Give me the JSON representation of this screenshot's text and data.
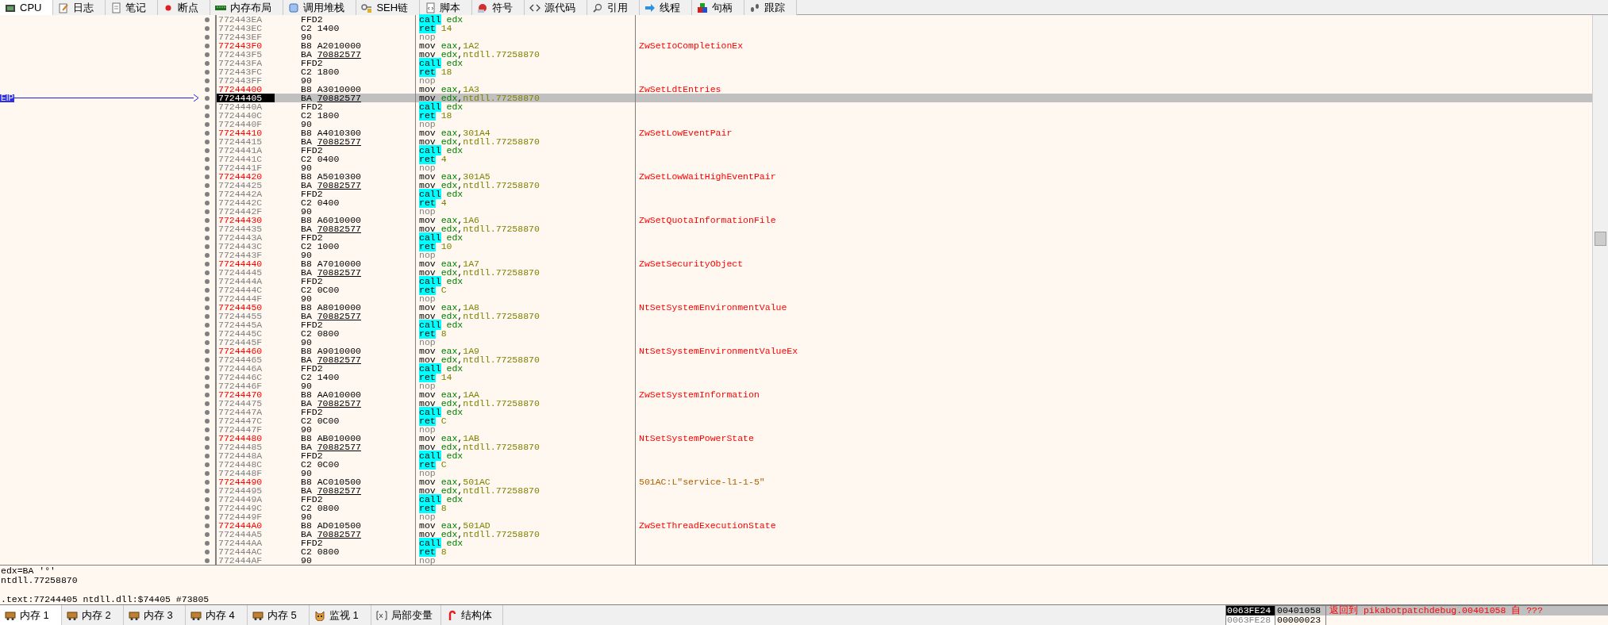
{
  "top_tabs": [
    {
      "label": "CPU",
      "selected": true
    },
    {
      "label": "日志",
      "selected": false
    },
    {
      "label": "笔记",
      "selected": false
    },
    {
      "label": "断点",
      "selected": false
    },
    {
      "label": "内存布局",
      "selected": false
    },
    {
      "label": "调用堆栈",
      "selected": false
    },
    {
      "label": "SEH链",
      "selected": false
    },
    {
      "label": "脚本",
      "selected": false
    },
    {
      "label": "符号",
      "selected": false
    },
    {
      "label": "源代码",
      "selected": false
    },
    {
      "label": "引用",
      "selected": false
    },
    {
      "label": "线程",
      "selected": false
    },
    {
      "label": "句柄",
      "selected": false
    },
    {
      "label": "跟踪",
      "selected": false
    }
  ],
  "eip_label": "EIP",
  "rows": [
    {
      "address": "772443EA",
      "label": false,
      "selected": false,
      "eip": false,
      "bytes": [
        "FFD2"
      ],
      "reloc": false,
      "mnemonic": "call",
      "kind": "call",
      "operands": "edx"
    },
    {
      "address": "772443EC",
      "label": false,
      "selected": false,
      "eip": false,
      "bytes": [
        "C2",
        "1400"
      ],
      "reloc": false,
      "mnemonic": "ret",
      "kind": "ret",
      "operands": "14"
    },
    {
      "address": "772443EF",
      "label": false,
      "selected": false,
      "eip": false,
      "bytes": [
        "90"
      ],
      "reloc": false,
      "mnemonic": "nop",
      "kind": "nop"
    },
    {
      "address": "772443F0",
      "label": true,
      "selected": false,
      "eip": false,
      "bytes": [
        "B8",
        "A2010000"
      ],
      "reloc": false,
      "mnemonic": "mov",
      "kind": "mov",
      "operands": "eax,1A2",
      "comment": {
        "text": "ZwSetIoCompletionEx",
        "kind": "label"
      }
    },
    {
      "address": "772443F5",
      "label": false,
      "selected": false,
      "eip": false,
      "bytes": [
        "BA",
        "70882577"
      ],
      "reloc": true,
      "mnemonic": "mov",
      "kind": "mov",
      "operands": "edx,ntdll.77258870"
    },
    {
      "address": "772443FA",
      "label": false,
      "selected": false,
      "eip": false,
      "bytes": [
        "FFD2"
      ],
      "reloc": false,
      "mnemonic": "call",
      "kind": "call",
      "operands": "edx"
    },
    {
      "address": "772443FC",
      "label": false,
      "selected": false,
      "eip": false,
      "bytes": [
        "C2",
        "1800"
      ],
      "reloc": false,
      "mnemonic": "ret",
      "kind": "ret",
      "operands": "18"
    },
    {
      "address": "772443FF",
      "label": false,
      "selected": false,
      "eip": false,
      "bytes": [
        "90"
      ],
      "reloc": false,
      "mnemonic": "nop",
      "kind": "nop"
    },
    {
      "address": "77244400",
      "label": true,
      "selected": false,
      "eip": false,
      "bytes": [
        "B8",
        "A3010000"
      ],
      "reloc": false,
      "mnemonic": "mov",
      "kind": "mov",
      "operands": "eax,1A3",
      "comment": {
        "text": "ZwSetLdtEntries",
        "kind": "label"
      }
    },
    {
      "address": "77244405",
      "label": false,
      "selected": true,
      "eip": true,
      "bytes": [
        "BA",
        "70882577"
      ],
      "reloc": true,
      "mnemonic": "mov",
      "kind": "mov",
      "operands": "edx,ntdll.77258870"
    },
    {
      "address": "7724440A",
      "label": false,
      "selected": false,
      "eip": false,
      "bytes": [
        "FFD2"
      ],
      "reloc": false,
      "mnemonic": "call",
      "kind": "call",
      "operands": "edx"
    },
    {
      "address": "7724440C",
      "label": false,
      "selected": false,
      "eip": false,
      "bytes": [
        "C2",
        "1800"
      ],
      "reloc": false,
      "mnemonic": "ret",
      "kind": "ret",
      "operands": "18"
    },
    {
      "address": "7724440F",
      "label": false,
      "selected": false,
      "eip": false,
      "bytes": [
        "90"
      ],
      "reloc": false,
      "mnemonic": "nop",
      "kind": "nop"
    },
    {
      "address": "77244410",
      "label": true,
      "selected": false,
      "eip": false,
      "bytes": [
        "B8",
        "A4010300"
      ],
      "reloc": false,
      "mnemonic": "mov",
      "kind": "mov",
      "operands": "eax,301A4",
      "comment": {
        "text": "ZwSetLowEventPair",
        "kind": "label"
      }
    },
    {
      "address": "77244415",
      "label": false,
      "selected": false,
      "eip": false,
      "bytes": [
        "BA",
        "70882577"
      ],
      "reloc": true,
      "mnemonic": "mov",
      "kind": "mov",
      "operands": "edx,ntdll.77258870"
    },
    {
      "address": "7724441A",
      "label": false,
      "selected": false,
      "eip": false,
      "bytes": [
        "FFD2"
      ],
      "reloc": false,
      "mnemonic": "call",
      "kind": "call",
      "operands": "edx"
    },
    {
      "address": "7724441C",
      "label": false,
      "selected": false,
      "eip": false,
      "bytes": [
        "C2",
        "0400"
      ],
      "reloc": false,
      "mnemonic": "ret",
      "kind": "ret",
      "operands": "4"
    },
    {
      "address": "7724441F",
      "label": false,
      "selected": false,
      "eip": false,
      "bytes": [
        "90"
      ],
      "reloc": false,
      "mnemonic": "nop",
      "kind": "nop"
    },
    {
      "address": "77244420",
      "label": true,
      "selected": false,
      "eip": false,
      "bytes": [
        "B8",
        "A5010300"
      ],
      "reloc": false,
      "mnemonic": "mov",
      "kind": "mov",
      "operands": "eax,301A5",
      "comment": {
        "text": "ZwSetLowWaitHighEventPair",
        "kind": "label"
      }
    },
    {
      "address": "77244425",
      "label": false,
      "selected": false,
      "eip": false,
      "bytes": [
        "BA",
        "70882577"
      ],
      "reloc": true,
      "mnemonic": "mov",
      "kind": "mov",
      "operands": "edx,ntdll.77258870"
    },
    {
      "address": "7724442A",
      "label": false,
      "selected": false,
      "eip": false,
      "bytes": [
        "FFD2"
      ],
      "reloc": false,
      "mnemonic": "call",
      "kind": "call",
      "operands": "edx"
    },
    {
      "address": "7724442C",
      "label": false,
      "selected": false,
      "eip": false,
      "bytes": [
        "C2",
        "0400"
      ],
      "reloc": false,
      "mnemonic": "ret",
      "kind": "ret",
      "operands": "4"
    },
    {
      "address": "7724442F",
      "label": false,
      "selected": false,
      "eip": false,
      "bytes": [
        "90"
      ],
      "reloc": false,
      "mnemonic": "nop",
      "kind": "nop"
    },
    {
      "address": "77244430",
      "label": true,
      "selected": false,
      "eip": false,
      "bytes": [
        "B8",
        "A6010000"
      ],
      "reloc": false,
      "mnemonic": "mov",
      "kind": "mov",
      "operands": "eax,1A6",
      "comment": {
        "text": "ZwSetQuotaInformationFile",
        "kind": "label"
      }
    },
    {
      "address": "77244435",
      "label": false,
      "selected": false,
      "eip": false,
      "bytes": [
        "BA",
        "70882577"
      ],
      "reloc": true,
      "mnemonic": "mov",
      "kind": "mov",
      "operands": "edx,ntdll.77258870"
    },
    {
      "address": "7724443A",
      "label": false,
      "selected": false,
      "eip": false,
      "bytes": [
        "FFD2"
      ],
      "reloc": false,
      "mnemonic": "call",
      "kind": "call",
      "operands": "edx"
    },
    {
      "address": "7724443C",
      "label": false,
      "selected": false,
      "eip": false,
      "bytes": [
        "C2",
        "1000"
      ],
      "reloc": false,
      "mnemonic": "ret",
      "kind": "ret",
      "operands": "10"
    },
    {
      "address": "7724443F",
      "label": false,
      "selected": false,
      "eip": false,
      "bytes": [
        "90"
      ],
      "reloc": false,
      "mnemonic": "nop",
      "kind": "nop"
    },
    {
      "address": "77244440",
      "label": true,
      "selected": false,
      "eip": false,
      "bytes": [
        "B8",
        "A7010000"
      ],
      "reloc": false,
      "mnemonic": "mov",
      "kind": "mov",
      "operands": "eax,1A7",
      "comment": {
        "text": "ZwSetSecurityObject",
        "kind": "label"
      }
    },
    {
      "address": "77244445",
      "label": false,
      "selected": false,
      "eip": false,
      "bytes": [
        "BA",
        "70882577"
      ],
      "reloc": true,
      "mnemonic": "mov",
      "kind": "mov",
      "operands": "edx,ntdll.77258870"
    },
    {
      "address": "7724444A",
      "label": false,
      "selected": false,
      "eip": false,
      "bytes": [
        "FFD2"
      ],
      "reloc": false,
      "mnemonic": "call",
      "kind": "call",
      "operands": "edx"
    },
    {
      "address": "7724444C",
      "label": false,
      "selected": false,
      "eip": false,
      "bytes": [
        "C2",
        "0C00"
      ],
      "reloc": false,
      "mnemonic": "ret",
      "kind": "ret",
      "operands": "C"
    },
    {
      "address": "7724444F",
      "label": false,
      "selected": false,
      "eip": false,
      "bytes": [
        "90"
      ],
      "reloc": false,
      "mnemonic": "nop",
      "kind": "nop"
    },
    {
      "address": "77244450",
      "label": true,
      "selected": false,
      "eip": false,
      "bytes": [
        "B8",
        "A8010000"
      ],
      "reloc": false,
      "mnemonic": "mov",
      "kind": "mov",
      "operands": "eax,1A8",
      "comment": {
        "text": "NtSetSystemEnvironmentValue",
        "kind": "label"
      }
    },
    {
      "address": "77244455",
      "label": false,
      "selected": false,
      "eip": false,
      "bytes": [
        "BA",
        "70882577"
      ],
      "reloc": true,
      "mnemonic": "mov",
      "kind": "mov",
      "operands": "edx,ntdll.77258870"
    },
    {
      "address": "7724445A",
      "label": false,
      "selected": false,
      "eip": false,
      "bytes": [
        "FFD2"
      ],
      "reloc": false,
      "mnemonic": "call",
      "kind": "call",
      "operands": "edx"
    },
    {
      "address": "7724445C",
      "label": false,
      "selected": false,
      "eip": false,
      "bytes": [
        "C2",
        "0800"
      ],
      "reloc": false,
      "mnemonic": "ret",
      "kind": "ret",
      "operands": "8"
    },
    {
      "address": "7724445F",
      "label": false,
      "selected": false,
      "eip": false,
      "bytes": [
        "90"
      ],
      "reloc": false,
      "mnemonic": "nop",
      "kind": "nop"
    },
    {
      "address": "77244460",
      "label": true,
      "selected": false,
      "eip": false,
      "bytes": [
        "B8",
        "A9010000"
      ],
      "reloc": false,
      "mnemonic": "mov",
      "kind": "mov",
      "operands": "eax,1A9",
      "comment": {
        "text": "NtSetSystemEnvironmentValueEx",
        "kind": "label"
      }
    },
    {
      "address": "77244465",
      "label": false,
      "selected": false,
      "eip": false,
      "bytes": [
        "BA",
        "70882577"
      ],
      "reloc": true,
      "mnemonic": "mov",
      "kind": "mov",
      "operands": "edx,ntdll.77258870"
    },
    {
      "address": "7724446A",
      "label": false,
      "selected": false,
      "eip": false,
      "bytes": [
        "FFD2"
      ],
      "reloc": false,
      "mnemonic": "call",
      "kind": "call",
      "operands": "edx"
    },
    {
      "address": "7724446C",
      "label": false,
      "selected": false,
      "eip": false,
      "bytes": [
        "C2",
        "1400"
      ],
      "reloc": false,
      "mnemonic": "ret",
      "kind": "ret",
      "operands": "14"
    },
    {
      "address": "7724446F",
      "label": false,
      "selected": false,
      "eip": false,
      "bytes": [
        "90"
      ],
      "reloc": false,
      "mnemonic": "nop",
      "kind": "nop"
    },
    {
      "address": "77244470",
      "label": true,
      "selected": false,
      "eip": false,
      "bytes": [
        "B8",
        "AA010000"
      ],
      "reloc": false,
      "mnemonic": "mov",
      "kind": "mov",
      "operands": "eax,1AA",
      "comment": {
        "text": "ZwSetSystemInformation",
        "kind": "label"
      }
    },
    {
      "address": "77244475",
      "label": false,
      "selected": false,
      "eip": false,
      "bytes": [
        "BA",
        "70882577"
      ],
      "reloc": true,
      "mnemonic": "mov",
      "kind": "mov",
      "operands": "edx,ntdll.77258870"
    },
    {
      "address": "7724447A",
      "label": false,
      "selected": false,
      "eip": false,
      "bytes": [
        "FFD2"
      ],
      "reloc": false,
      "mnemonic": "call",
      "kind": "call",
      "operands": "edx"
    },
    {
      "address": "7724447C",
      "label": false,
      "selected": false,
      "eip": false,
      "bytes": [
        "C2",
        "0C00"
      ],
      "reloc": false,
      "mnemonic": "ret",
      "kind": "ret",
      "operands": "C"
    },
    {
      "address": "7724447F",
      "label": false,
      "selected": false,
      "eip": false,
      "bytes": [
        "90"
      ],
      "reloc": false,
      "mnemonic": "nop",
      "kind": "nop"
    },
    {
      "address": "77244480",
      "label": true,
      "selected": false,
      "eip": false,
      "bytes": [
        "B8",
        "AB010000"
      ],
      "reloc": false,
      "mnemonic": "mov",
      "kind": "mov",
      "operands": "eax,1AB",
      "comment": {
        "text": "NtSetSystemPowerState",
        "kind": "label"
      }
    },
    {
      "address": "77244485",
      "label": false,
      "selected": false,
      "eip": false,
      "bytes": [
        "BA",
        "70882577"
      ],
      "reloc": true,
      "mnemonic": "mov",
      "kind": "mov",
      "operands": "edx,ntdll.77258870"
    },
    {
      "address": "7724448A",
      "label": false,
      "selected": false,
      "eip": false,
      "bytes": [
        "FFD2"
      ],
      "reloc": false,
      "mnemonic": "call",
      "kind": "call",
      "operands": "edx"
    },
    {
      "address": "7724448C",
      "label": false,
      "selected": false,
      "eip": false,
      "bytes": [
        "C2",
        "0C00"
      ],
      "reloc": false,
      "mnemonic": "ret",
      "kind": "ret",
      "operands": "C"
    },
    {
      "address": "7724448F",
      "label": false,
      "selected": false,
      "eip": false,
      "bytes": [
        "90"
      ],
      "reloc": false,
      "mnemonic": "nop",
      "kind": "nop"
    },
    {
      "address": "77244490",
      "label": true,
      "selected": false,
      "eip": false,
      "bytes": [
        "B8",
        "AC010500"
      ],
      "reloc": false,
      "mnemonic": "mov",
      "kind": "mov",
      "operands": "eax,501AC",
      "comment": {
        "text": "501AC:L\"service-l1-1-5\"",
        "kind": "string"
      }
    },
    {
      "address": "77244495",
      "label": false,
      "selected": false,
      "eip": false,
      "bytes": [
        "BA",
        "70882577"
      ],
      "reloc": true,
      "mnemonic": "mov",
      "kind": "mov",
      "operands": "edx,ntdll.77258870"
    },
    {
      "address": "7724449A",
      "label": false,
      "selected": false,
      "eip": false,
      "bytes": [
        "FFD2"
      ],
      "reloc": false,
      "mnemonic": "call",
      "kind": "call",
      "operands": "edx"
    },
    {
      "address": "7724449C",
      "label": false,
      "selected": false,
      "eip": false,
      "bytes": [
        "C2",
        "0800"
      ],
      "reloc": false,
      "mnemonic": "ret",
      "kind": "ret",
      "operands": "8"
    },
    {
      "address": "7724449F",
      "label": false,
      "selected": false,
      "eip": false,
      "bytes": [
        "90"
      ],
      "reloc": false,
      "mnemonic": "nop",
      "kind": "nop"
    },
    {
      "address": "772444A0",
      "label": true,
      "selected": false,
      "eip": false,
      "bytes": [
        "B8",
        "AD010500"
      ],
      "reloc": false,
      "mnemonic": "mov",
      "kind": "mov",
      "operands": "eax,501AD",
      "comment": {
        "text": "ZwSetThreadExecutionState",
        "kind": "label"
      }
    },
    {
      "address": "772444A5",
      "label": false,
      "selected": false,
      "eip": false,
      "bytes": [
        "BA",
        "70882577"
      ],
      "reloc": true,
      "mnemonic": "mov",
      "kind": "mov",
      "operands": "edx,ntdll.77258870"
    },
    {
      "address": "772444AA",
      "label": false,
      "selected": false,
      "eip": false,
      "bytes": [
        "FFD2"
      ],
      "reloc": false,
      "mnemonic": "call",
      "kind": "call",
      "operands": "edx"
    },
    {
      "address": "772444AC",
      "label": false,
      "selected": false,
      "eip": false,
      "bytes": [
        "C2",
        "0800"
      ],
      "reloc": false,
      "mnemonic": "ret",
      "kind": "ret",
      "operands": "8"
    },
    {
      "address": "772444AF",
      "label": false,
      "selected": false,
      "eip": false,
      "bytes": [
        "90"
      ],
      "reloc": false,
      "mnemonic": "nop",
      "kind": "nop"
    }
  ],
  "info_panel": {
    "lines": [
      "edx=BA '°'",
      "ntdll.77258870"
    ],
    "location": ".text:77244405 ntdll.dll:$74405 #73805"
  },
  "bottom_tabs": [
    {
      "label": "内存 1",
      "selected": true
    },
    {
      "label": "内存 2",
      "selected": false
    },
    {
      "label": "内存 3",
      "selected": false
    },
    {
      "label": "内存 4",
      "selected": false
    },
    {
      "label": "内存 5",
      "selected": false
    },
    {
      "label": "监视 1",
      "selected": false
    },
    {
      "label": "局部变量",
      "selected": false
    },
    {
      "label": "结构体",
      "selected": false
    }
  ],
  "stack": [
    {
      "address": "0063FE24",
      "value": "00401058",
      "comment": "返回到 pikabotpatchdebug.00401058 自 ???",
      "selected": true
    },
    {
      "address": "0063FE28",
      "value": "00000023",
      "selected": false
    }
  ]
}
